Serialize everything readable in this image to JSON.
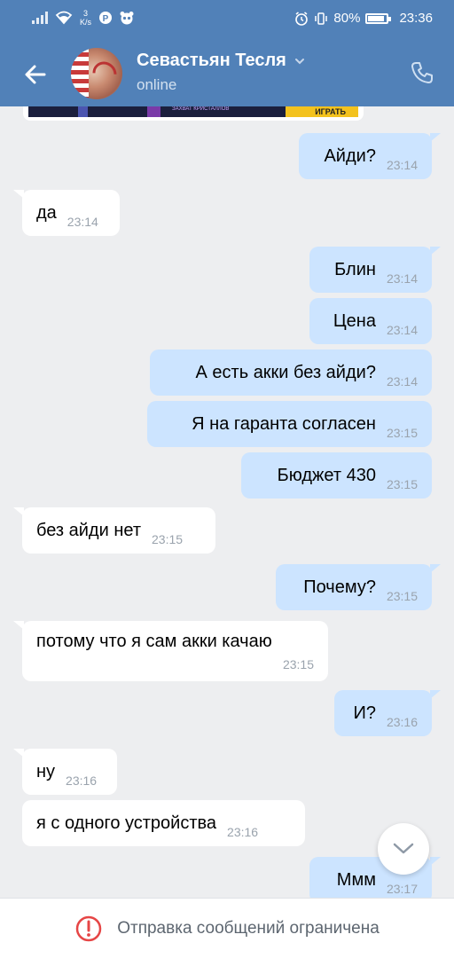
{
  "status_bar": {
    "net_speed_top": "3",
    "net_speed_unit": "K/s",
    "battery_percent": "80%",
    "time": "23:36",
    "icons": [
      "signal-icon",
      "wifi-icon",
      "vk-notification-icon",
      "panda-notification-icon",
      "alarm-icon",
      "vibrate-icon",
      "battery-icon"
    ]
  },
  "header": {
    "contact_name": "Севастьян Тесля",
    "status": "online",
    "back_icon": "arrow-left-icon",
    "call_icon": "phone-icon",
    "accent_color": "#5181b8"
  },
  "preview": {
    "text": "ЗАХВАТ КРИСТАЛЛОВ",
    "button": "ИГРАТЬ"
  },
  "messages": [
    {
      "dir": "out",
      "text": "Айди?",
      "time": "23:14"
    },
    {
      "dir": "in",
      "text": "да",
      "time": "23:14"
    },
    {
      "dir": "out",
      "text": "Блин",
      "time": "23:14"
    },
    {
      "dir": "out",
      "text": "Цена",
      "time": "23:14"
    },
    {
      "dir": "out",
      "text": "А есть акки без айди?",
      "time": "23:14"
    },
    {
      "dir": "out",
      "text": "Я на гаранта согласен",
      "time": "23:15"
    },
    {
      "dir": "out",
      "text": "Бюджет 430",
      "time": "23:15"
    },
    {
      "dir": "in",
      "text": "без айди нет",
      "time": "23:15"
    },
    {
      "dir": "out",
      "text": "Почему?",
      "time": "23:15"
    },
    {
      "dir": "in",
      "text": "потому что я сам акки качаю",
      "time": "23:15"
    },
    {
      "dir": "out",
      "text": "И?",
      "time": "23:16"
    },
    {
      "dir": "in",
      "text": "ну",
      "time": "23:16"
    },
    {
      "dir": "in",
      "text": "я с одного устройства",
      "time": "23:16"
    },
    {
      "dir": "out",
      "text": "Ммм",
      "time": "23:17"
    }
  ],
  "bottom_banner": {
    "text": "Отправка сообщений ограничена",
    "icon": "alert-circle-icon"
  },
  "colors": {
    "outgoing_bubble": "#cce4ff",
    "incoming_bubble": "#ffffff",
    "chat_background": "#edeef0",
    "warning_red": "#e64646"
  }
}
